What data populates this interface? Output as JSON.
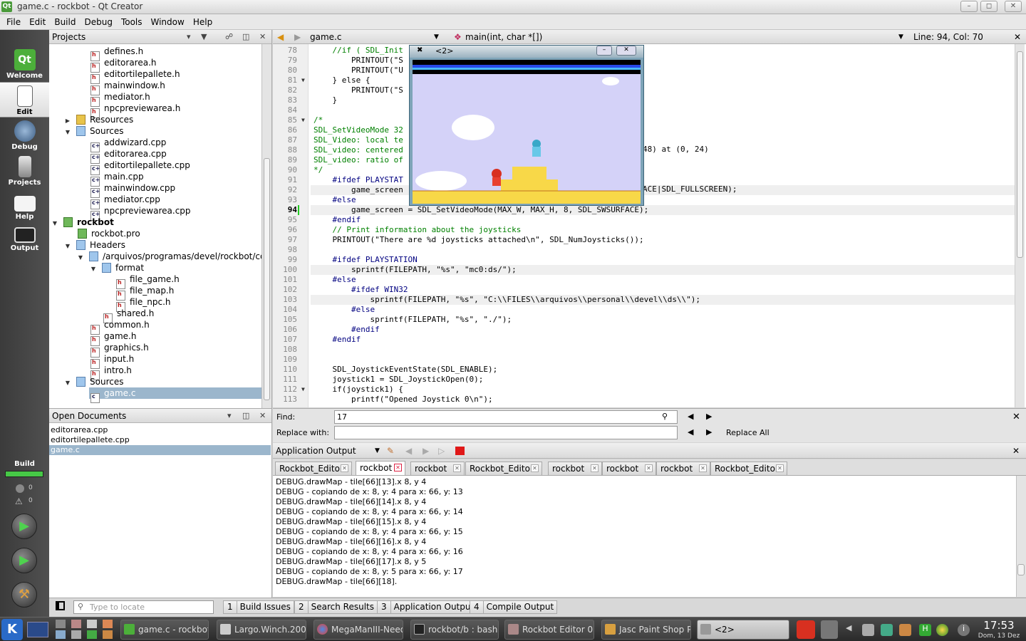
{
  "window": {
    "title": "game.c - rockbot - Qt Creator",
    "app_icon": "Qt"
  },
  "menu": [
    "File",
    "Edit",
    "Build",
    "Debug",
    "Tools",
    "Window",
    "Help"
  ],
  "modes": [
    {
      "label": "Welcome",
      "icon": "qt-logo-icon"
    },
    {
      "label": "Edit",
      "icon": "edit-document-icon"
    },
    {
      "label": "Debug",
      "icon": "bug-icon"
    },
    {
      "label": "Projects",
      "icon": "projects-icon"
    },
    {
      "label": "Help",
      "icon": "book-icon"
    },
    {
      "label": "Output",
      "icon": "monitor-icon"
    }
  ],
  "build": {
    "label": "Build",
    "errors": "0",
    "warnings": "0"
  },
  "projects": {
    "title": "Projects",
    "tree": [
      {
        "label": "defines.h"
      },
      {
        "label": "editorarea.h"
      },
      {
        "label": "editortilepallete.h"
      },
      {
        "label": "mainwindow.h"
      },
      {
        "label": "mediator.h"
      },
      {
        "label": "npcpreviewarea.h"
      },
      {
        "label": "Resources"
      },
      {
        "label": "Sources"
      },
      {
        "label": "addwizard.cpp"
      },
      {
        "label": "editorarea.cpp"
      },
      {
        "label": "editortilepallete.cpp"
      },
      {
        "label": "main.cpp"
      },
      {
        "label": "mainwindow.cpp"
      },
      {
        "label": "mediator.cpp"
      },
      {
        "label": "npcpreviewarea.cpp"
      },
      {
        "label": "rockbot"
      },
      {
        "label": "rockbot.pro"
      },
      {
        "label": "Headers"
      },
      {
        "label": "/arquivos/programas/devel/rockbot/co"
      },
      {
        "label": "format"
      },
      {
        "label": "file_game.h"
      },
      {
        "label": "file_map.h"
      },
      {
        "label": "file_npc.h"
      },
      {
        "label": "shared.h"
      },
      {
        "label": "common.h"
      },
      {
        "label": "game.h"
      },
      {
        "label": "graphics.h"
      },
      {
        "label": "input.h"
      },
      {
        "label": "intro.h"
      },
      {
        "label": "Sources"
      },
      {
        "label": "game.c"
      }
    ]
  },
  "open_documents": {
    "title": "Open Documents",
    "items": [
      "editorarea.cpp",
      "editortilepallete.cpp",
      "game.c"
    ]
  },
  "editor_toolbar": {
    "file": "game.c",
    "function": "main(int, char *[])",
    "position": "Line: 94, Col: 70"
  },
  "code": {
    "lines": [
      {
        "n": "78",
        "t": "    //if ( SDL_Init"
      },
      {
        "n": "79",
        "t": "        PRINTOUT(\"S"
      },
      {
        "n": "80",
        "t": "        PRINTOUT(\"U"
      },
      {
        "n": "81",
        "t": "    } else {"
      },
      {
        "n": "82",
        "t": "        PRINTOUT(\"S"
      },
      {
        "n": "83",
        "t": "    }"
      },
      {
        "n": "84",
        "t": ""
      },
      {
        "n": "85",
        "t": "/*"
      },
      {
        "n": "86",
        "t": "SDL_SetVideoMode 32"
      },
      {
        "n": "87",
        "t": "SDL_Video: local te"
      },
      {
        "n": "88",
        "t": "SDL_video: centered"
      },
      {
        "n": "89",
        "t": "SDL_video: ratio of"
      },
      {
        "n": "90",
        "t": "*/"
      },
      {
        "n": "91",
        "t": "    #ifdef PLAYSTAT"
      },
      {
        "n": "92",
        "t": "        game_screen"
      },
      {
        "n": "93",
        "t": "    #else"
      },
      {
        "n": "94",
        "t": "        game_screen = SDL_SetVideoMode(MAX_W, MAX_H, 8, SDL_SWSURFACE);"
      },
      {
        "n": "95",
        "t": "    #endif"
      },
      {
        "n": "96",
        "t": "    // Print information about the joysticks"
      },
      {
        "n": "97",
        "t": "    PRINTOUT(\"There are %d joysticks attached\\n\", SDL_NumJoysticks());"
      },
      {
        "n": "98",
        "t": ""
      },
      {
        "n": "99",
        "t": "    #ifdef PLAYSTATION"
      },
      {
        "n": "100",
        "t": "        sprintf(FILEPATH, \"%s\", \"mc0:ds/\");"
      },
      {
        "n": "101",
        "t": "    #else"
      },
      {
        "n": "102",
        "t": "        #ifdef WIN32"
      },
      {
        "n": "103",
        "t": "            sprintf(FILEPATH, \"%s\", \"C:\\\\FILES\\\\arquivos\\\\personal\\\\devel\\\\ds\\\\\");"
      },
      {
        "n": "104",
        "t": "        #else"
      },
      {
        "n": "105",
        "t": "            sprintf(FILEPATH, \"%s\", \"./\");"
      },
      {
        "n": "106",
        "t": "        #endif"
      },
      {
        "n": "107",
        "t": "    #endif"
      },
      {
        "n": "108",
        "t": ""
      },
      {
        "n": "109",
        "t": ""
      },
      {
        "n": "110",
        "t": "    SDL_JoystickEventState(SDL_ENABLE);"
      },
      {
        "n": "111",
        "t": "    joystick1 = SDL_JoystickOpen(0);"
      },
      {
        "n": "112",
        "t": "    if(joystick1) {"
      },
      {
        "n": "113",
        "t": "        printf(\"Opened Joystick 0\\n\");"
      }
    ],
    "overflow_right": {
      "l88": "48) at (0, 24)",
      "l92": "ACE|SDL_FULLSCREEN);"
    }
  },
  "sdl_window": {
    "title": "<2>"
  },
  "find": {
    "find_label": "Find:",
    "find_value": "17",
    "replace_label": "Replace with:",
    "replace_value": "",
    "replace_all": "Replace All"
  },
  "output": {
    "title": "Application Output",
    "tabs": [
      "Rockbot_Editor",
      "rockbot",
      "rockbot",
      "Rockbot_Editor",
      "rockbot",
      "rockbot",
      "rockbot",
      "Rockbot_Editor"
    ],
    "lines": [
      "DEBUG.drawMap - tile[66][13].x 8, y 4",
      "DEBUG - copiando de x: 8, y: 4 para x: 66, y: 13",
      "DEBUG.drawMap - tile[66][14].x 8, y 4",
      "DEBUG - copiando de x: 8, y: 4 para x: 66, y: 14",
      "DEBUG.drawMap - tile[66][15].x 8, y 4",
      "DEBUG - copiando de x: 8, y: 4 para x: 66, y: 15",
      "DEBUG.drawMap - tile[66][16].x 8, y 4",
      "DEBUG - copiando de x: 8, y: 4 para x: 66, y: 16",
      "DEBUG.drawMap - tile[66][17].x 8, y 5",
      "DEBUG - copiando de x: 8, y: 5 para x: 66, y: 17",
      "DEBUG.drawMap - tile[66][18]."
    ]
  },
  "bottom": {
    "locate_placeholder": "Type to locate",
    "panes": [
      {
        "n": "1",
        "label": "Build Issues"
      },
      {
        "n": "2",
        "label": "Search Results"
      },
      {
        "n": "3",
        "label": "Application Output"
      },
      {
        "n": "4",
        "label": "Compile Output"
      }
    ]
  },
  "taskbar": {
    "tasks": [
      "game.c - rockbot",
      "Largo.Winch.200",
      "MegaManIII-Need",
      "rockbot/b : bash",
      "Rockbot Editor 0",
      "Jasc Paint Shop P",
      "<2>"
    ],
    "clock": "17:53",
    "date": "Dom, 13 Dez"
  },
  "colors": {
    "selection": "#9bb6cc",
    "modebar": "#404040",
    "build_ok": "#46c846"
  }
}
